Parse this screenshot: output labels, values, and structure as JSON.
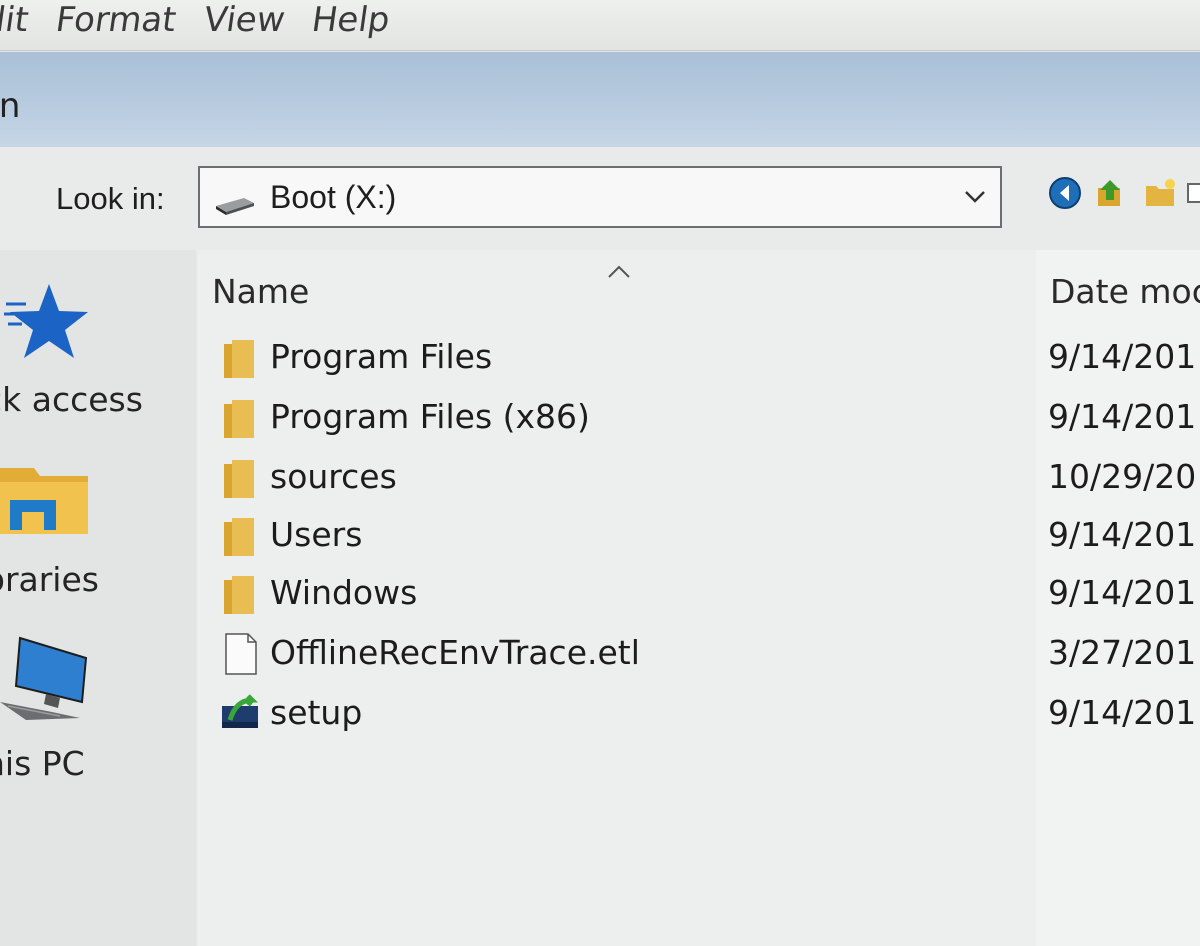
{
  "menu": {
    "items": [
      "lit",
      "Format",
      "View",
      "Help"
    ]
  },
  "window": {
    "title": "en"
  },
  "lookin": {
    "label": "Look in:",
    "value": "Boot (X:)"
  },
  "toolbar": {
    "icons": [
      "back-icon",
      "up-folder-icon",
      "new-folder-icon",
      "view-menu-icon"
    ]
  },
  "places": [
    {
      "label": "ck access",
      "icon": "quick-access-star-icon"
    },
    {
      "label": "braries",
      "icon": "libraries-icon"
    },
    {
      "label": "his PC",
      "icon": "this-pc-icon"
    }
  ],
  "list": {
    "columns": {
      "name": "Name",
      "date": "Date moc"
    },
    "rows": [
      {
        "name": "Program Files",
        "date": "9/14/201",
        "icon": "folder-icon"
      },
      {
        "name": "Program Files (x86)",
        "date": "9/14/201",
        "icon": "folder-icon"
      },
      {
        "name": "sources",
        "date": "10/29/20",
        "icon": "folder-icon"
      },
      {
        "name": "Users",
        "date": "9/14/201",
        "icon": "folder-icon"
      },
      {
        "name": "Windows",
        "date": "9/14/201",
        "icon": "folder-icon"
      },
      {
        "name": "OfflineRecEnvTrace.etl",
        "date": "3/27/201",
        "icon": "file-icon"
      },
      {
        "name": "setup",
        "date": "9/14/201",
        "icon": "setup-icon"
      }
    ]
  },
  "colors": {
    "titlebar": "#b4c8dc",
    "folder": "#d9a52e",
    "star": "#1b63c4"
  }
}
